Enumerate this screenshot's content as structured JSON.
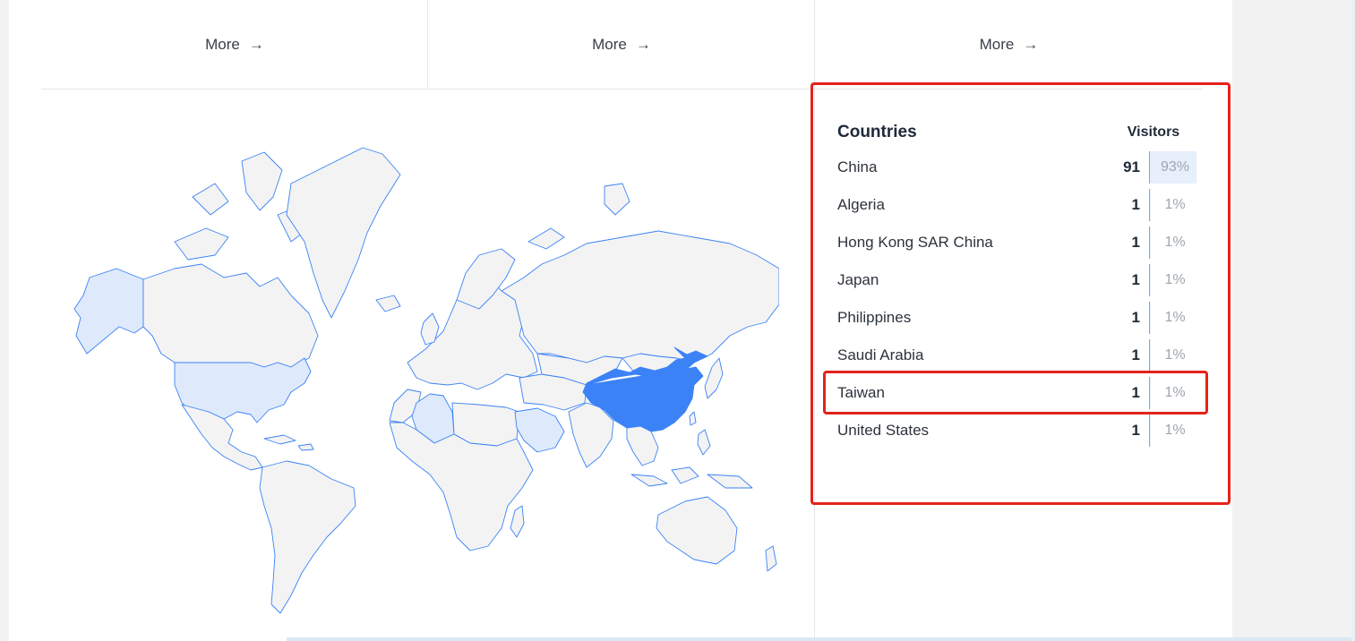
{
  "more_links": [
    {
      "label": "More"
    },
    {
      "label": "More"
    },
    {
      "label": "More"
    }
  ],
  "countries": {
    "title": "Countries",
    "visitors_label": "Visitors",
    "rows": [
      {
        "name": "China",
        "count": "91",
        "percent": "93%",
        "share": 0.93
      },
      {
        "name": "Algeria",
        "count": "1",
        "percent": "1%",
        "share": 0.01
      },
      {
        "name": "Hong Kong SAR China",
        "count": "1",
        "percent": "1%",
        "share": 0.01
      },
      {
        "name": "Japan",
        "count": "1",
        "percent": "1%",
        "share": 0.01
      },
      {
        "name": "Philippines",
        "count": "1",
        "percent": "1%",
        "share": 0.01
      },
      {
        "name": "Saudi Arabia",
        "count": "1",
        "percent": "1%",
        "share": 0.01
      },
      {
        "name": "Taiwan",
        "count": "1",
        "percent": "1%",
        "share": 0.01
      },
      {
        "name": "United States",
        "count": "1",
        "percent": "1%",
        "share": 0.01
      }
    ]
  },
  "colors": {
    "highlight_country": "#3b82f6",
    "visited_country": "#deeafb",
    "land": "#f3f3f3",
    "border": "#3b82f6",
    "annotation": "#e3231b"
  },
  "map": {
    "highlighted": "China",
    "visited": [
      "United States",
      "Algeria",
      "Saudi Arabia",
      "Alaska"
    ]
  }
}
